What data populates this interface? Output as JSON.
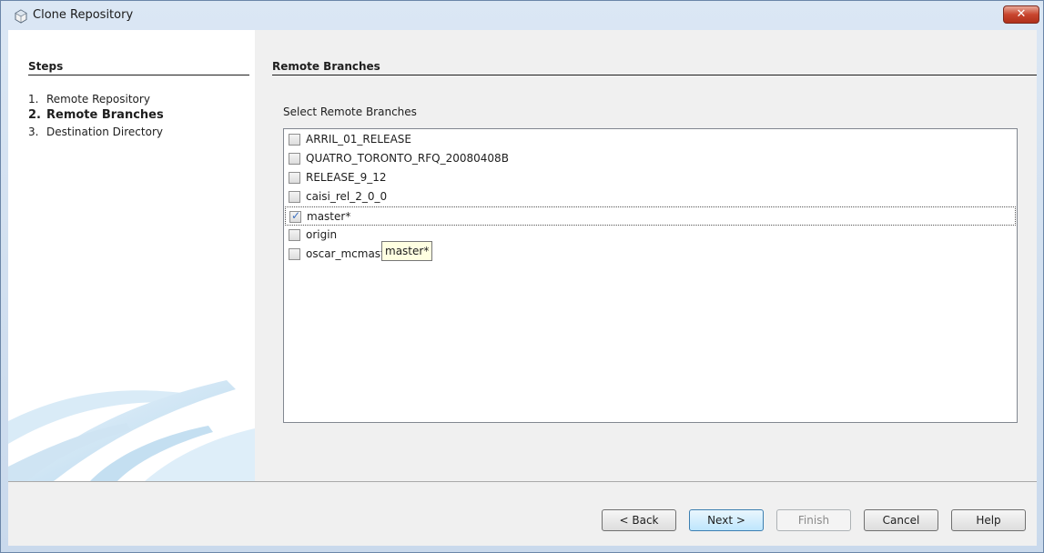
{
  "window": {
    "title": "Clone Repository",
    "close_label": "✕"
  },
  "steps": {
    "title": "Steps",
    "items": [
      {
        "num": "1.",
        "label": "Remote Repository"
      },
      {
        "num": "2.",
        "label": "Remote Branches"
      },
      {
        "num": "3.",
        "label": "Destination Directory"
      }
    ]
  },
  "panel": {
    "title": "Remote Branches",
    "select_label": "Select Remote Branches",
    "branches": [
      {
        "label": "ARRIL_01_RELEASE",
        "checked": false
      },
      {
        "label": "QUATRO_TORONTO_RFQ_20080408B",
        "checked": false
      },
      {
        "label": "RELEASE_9_12",
        "checked": false
      },
      {
        "label": "caisi_rel_2_0_0",
        "checked": false
      },
      {
        "label": "master*",
        "checked": true
      },
      {
        "label": "origin",
        "checked": false
      },
      {
        "label": "oscar_mcmaster_beta",
        "checked": false
      }
    ],
    "tooltip": "master*"
  },
  "buttons": {
    "back": "< Back",
    "next": "Next >",
    "finish": "Finish",
    "cancel": "Cancel",
    "help": "Help"
  }
}
